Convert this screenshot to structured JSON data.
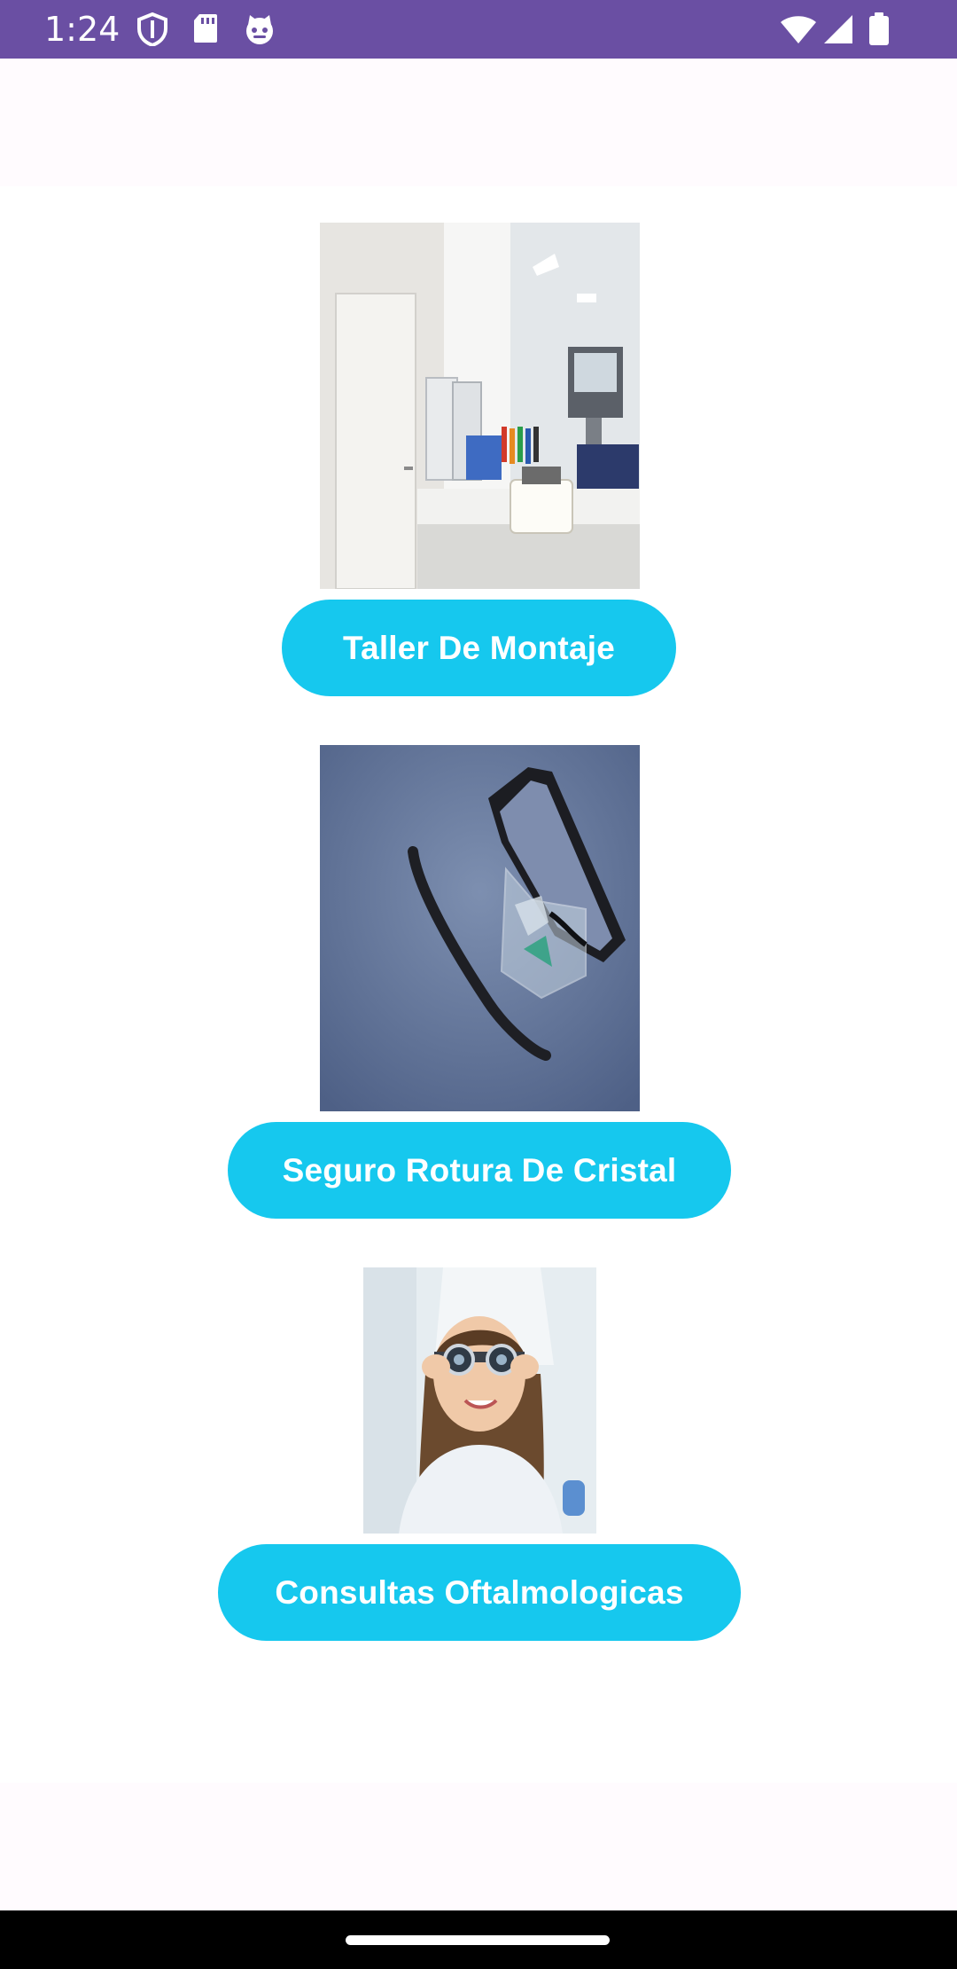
{
  "status_bar": {
    "time": "1:24",
    "left_icons": [
      "shield-icon",
      "sd-card-icon",
      "cat-face-icon"
    ],
    "right_icons": [
      "wifi-icon",
      "signal-icon",
      "battery-icon"
    ],
    "background": "#6a4fa3"
  },
  "services": [
    {
      "button_label": "Taller De Montaje",
      "image": "optical-workshop-photo"
    },
    {
      "button_label": "Seguro Rotura De Cristal",
      "image": "broken-glasses-photo"
    },
    {
      "button_label": "Consultas Oftalmologicas",
      "image": "eye-exam-photo"
    }
  ],
  "colors": {
    "button": "#16c8ee",
    "button_text": "#ffffff",
    "app_bar": "#fffbfe",
    "background": "#ffffff"
  }
}
